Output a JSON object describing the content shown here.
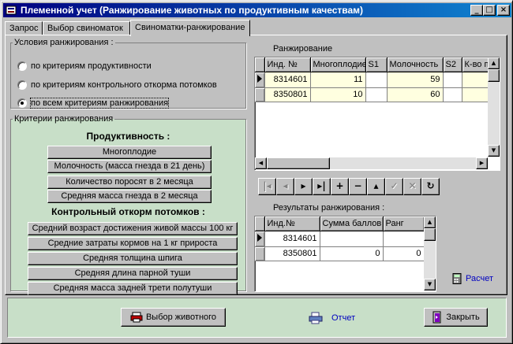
{
  "window": {
    "title": "Племенной учет (Ранжирование животных по продуктивным качествам)"
  },
  "tabs": [
    {
      "label": "Запрос"
    },
    {
      "label": "Выбор свиноматок"
    },
    {
      "label": "Свиноматки-ранжирование"
    }
  ],
  "conditions": {
    "legend": "Условия ранжирования :",
    "options": [
      {
        "label": "по критериям продуктивности",
        "selected": false
      },
      {
        "label": "по критериям контрольного откорма потомков",
        "selected": false
      },
      {
        "label": "по всем критериям ранжирования",
        "selected": true
      }
    ]
  },
  "criteria": {
    "legend": "Критерии ранжирования",
    "productivity_header": "Продуктивность :",
    "productivity_buttons": [
      "Многоплодие",
      "Молочность (масса гнезда в 21 день)",
      "Количество поросят в 2 месяца",
      "Средняя масса гнезда в 2 месяца"
    ],
    "fattening_header": "Контрольный откорм потомков :",
    "fattening_buttons": [
      "Средний возраст достижения живой массы 100 кг",
      "Средние затраты кормов на 1 кг прироста",
      "Средняя толщина шпига",
      "Средняя длина парной туши",
      "Средняя масса задней трети полутуши"
    ]
  },
  "ranking": {
    "label": "Ранжирование",
    "columns": [
      "Инд. №",
      "Многоплодие",
      "S1",
      "Молочность",
      "S2",
      "К-во п"
    ],
    "rows": [
      [
        "8314601",
        "11",
        "",
        "59",
        "",
        ""
      ],
      [
        "8350801",
        "10",
        "",
        "60",
        "",
        ""
      ]
    ]
  },
  "navigator": {
    "buttons": [
      "first",
      "prior",
      "next",
      "last",
      "insert",
      "delete",
      "edit",
      "post",
      "cancel",
      "refresh"
    ]
  },
  "results": {
    "label": "Результаты ранжирования :",
    "columns": [
      "Инд.№",
      "Сумма баллов",
      "Ранг"
    ],
    "rows": [
      [
        "8314601",
        "",
        ""
      ],
      [
        "8350801",
        "0",
        "0"
      ]
    ]
  },
  "calc_link": "Расчет",
  "footer": {
    "select_animal": "Выбор животного",
    "report": "Отчет",
    "close": "Закрыть"
  },
  "colors": {
    "title_bar": "#000080",
    "criteria_bg": "#c8dfc8",
    "highlight_cell": "#ffffe0",
    "link": "#0000c0"
  }
}
